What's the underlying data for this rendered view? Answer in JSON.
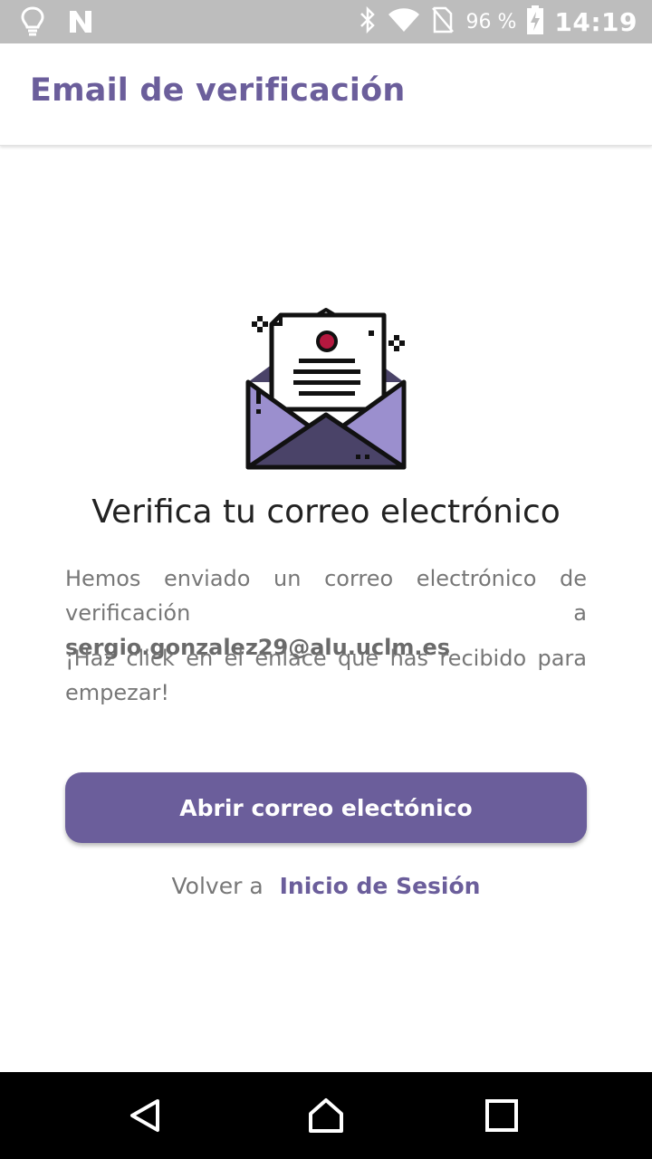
{
  "status_bar": {
    "battery_percent": "96 %",
    "time": "14:19",
    "icons": [
      "lightbulb-icon",
      "n-logo-icon",
      "bluetooth-icon",
      "wifi-icon",
      "no-sim-icon",
      "battery-charging-icon"
    ]
  },
  "app_bar": {
    "title": "Email de verificación"
  },
  "main": {
    "illustration_icon": "open-envelope-letter-icon",
    "heading": "Verifica tu correo electrónico",
    "paragraph1_prefix": "Hemos enviado un correo electrónico de verificación a ",
    "email": "sergio.gonzalez29@alu.uclm.es",
    "paragraph2": "¡Haz click en el enlace que has recibido para empezar!",
    "open_mail_button": "Abrir correo electónico",
    "back_prefix": "Volver a",
    "back_link": "Inicio de Sesión"
  },
  "nav_bar": {
    "buttons": [
      "back-triangle-icon",
      "home-icon",
      "recents-square-icon"
    ]
  },
  "colors": {
    "accent": "#6b5e9b",
    "status_bar": "#bdbdbd",
    "envelope": "#9b8fce",
    "envelope_dark": "#4a4368",
    "seal": "#b5183f"
  }
}
